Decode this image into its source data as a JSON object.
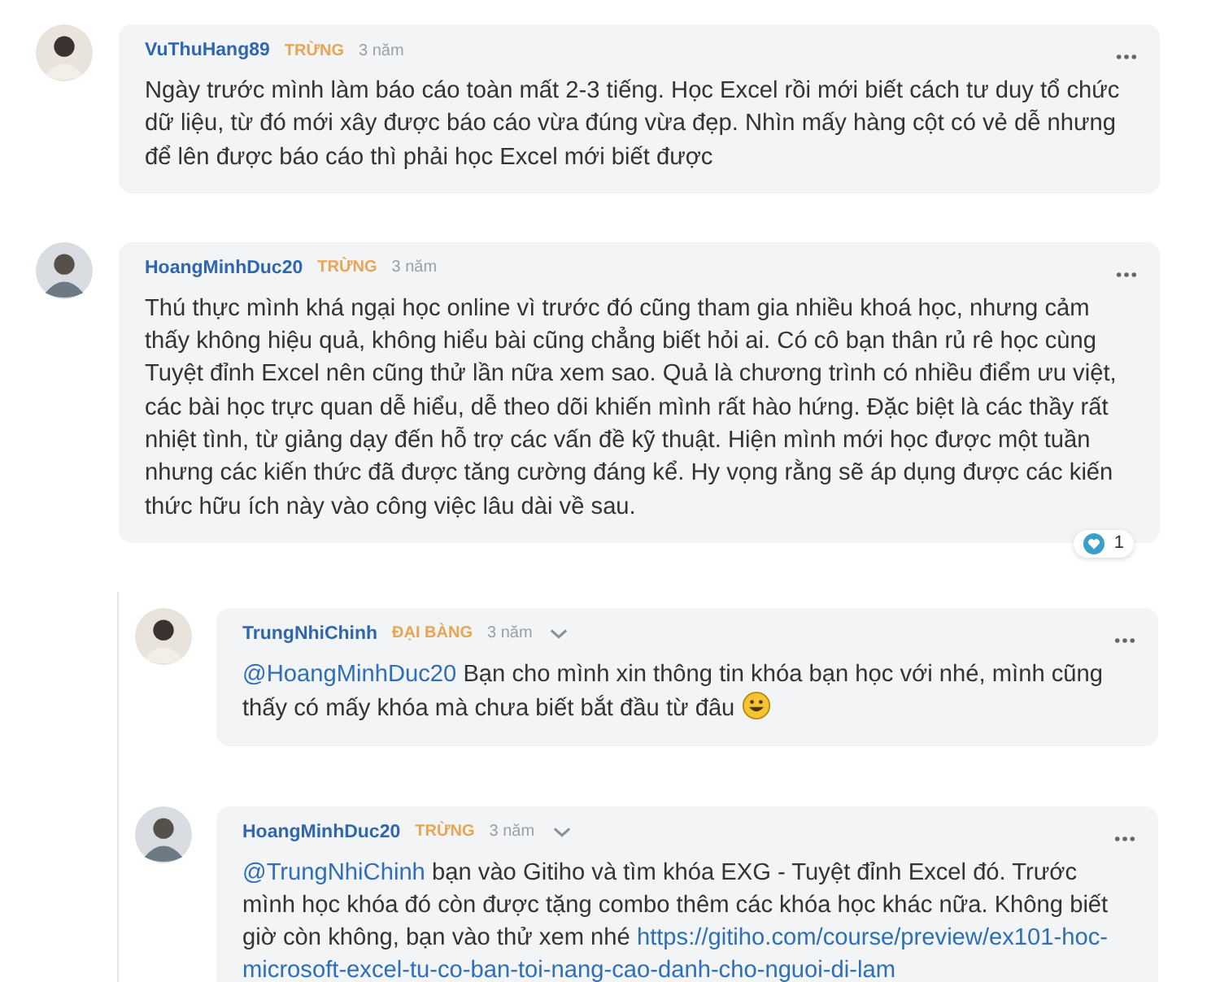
{
  "comments": [
    {
      "author": "VuThuHang89",
      "badge": "TRỪNG",
      "time": "3 năm",
      "body": [
        {
          "kind": "text",
          "text": "Ngày trước mình làm báo cáo toàn mất 2-3 tiếng. Học Excel rồi mới biết cách tư duy tổ chức dữ liệu, từ đó mới xây được báo cáo vừa đúng vừa đẹp. Nhìn mấy hàng cột có vẻ dễ nhưng để lên được báo cáo thì phải học Excel mới biết được"
        }
      ]
    },
    {
      "author": "HoangMinhDuc20",
      "badge": "TRỪNG",
      "time": "3 năm",
      "likes": "1",
      "body": [
        {
          "kind": "text",
          "text": "Thú thực mình khá ngại học online vì trước đó cũng tham gia nhiều khoá học, nhưng cảm thấy không hiệu quả, không hiểu bài cũng chẳng biết hỏi ai. Có cô bạn thân rủ rê học cùng Tuyệt đỉnh Excel nên cũng thử lần nữa xem sao. Quả là chương trình có nhiều điểm ưu việt, các bài học trực quan dễ hiểu, dễ theo dõi khiến mình rất hào hứng. Đặc biệt là các thầy rất nhiệt tình, từ giảng dạy đến hỗ trợ các vấn đề kỹ thuật. Hiện mình mới học được một tuần nhưng các kiến thức đã được tăng cường đáng kể. Hy vọng rằng sẽ áp dụng được các kiến thức hữu ích này vào công việc lâu dài về sau."
        }
      ],
      "replies": [
        {
          "author": "TrungNhiChinh",
          "badge": "ĐẠI BÀNG",
          "time": "3 năm",
          "body": [
            {
              "kind": "mention",
              "text": "@HoangMinhDuc20"
            },
            {
              "kind": "text",
              "text": " Bạn cho mình xin thông tin khóa bạn học với nhé, mình cũng thấy có mấy khóa mà chưa biết bắt đầu từ đâu "
            },
            {
              "kind": "emoji"
            }
          ]
        },
        {
          "author": "HoangMinhDuc20",
          "badge": "TRỪNG",
          "time": "3 năm",
          "body": [
            {
              "kind": "mention",
              "text": "@TrungNhiChinh"
            },
            {
              "kind": "text",
              "text": " bạn vào Gitiho và tìm khóa EXG - Tuyệt đỉnh Excel đó. Trước mình học khóa đó còn được tặng combo thêm các khóa học khác nữa. Không biết giờ còn không, bạn vào thử xem nhé "
            },
            {
              "kind": "link",
              "text": "https://gitiho.com/course/preview/ex101-hoc-"
            },
            {
              "kind": "link",
              "text": "microsoft-excel-tu-co-ban-toi-nang-cao-danh-cho-nguoi-di-lam"
            }
          ]
        }
      ]
    }
  ]
}
